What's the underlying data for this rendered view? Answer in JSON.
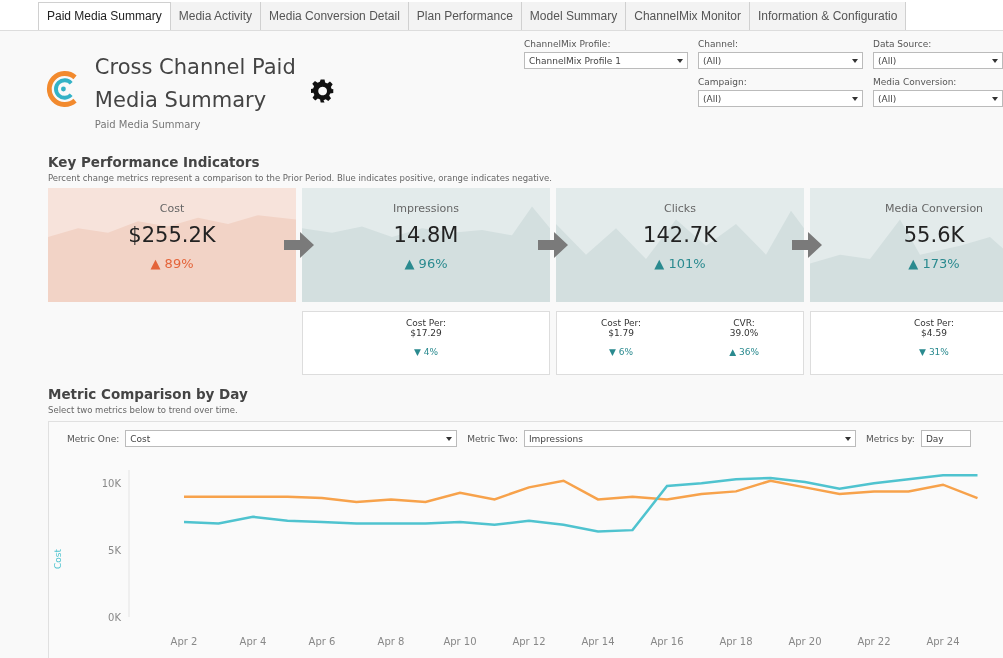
{
  "tabs": [
    {
      "label": "Paid Media Summary",
      "selected": true
    },
    {
      "label": "Media Activity",
      "selected": false
    },
    {
      "label": "Media Conversion Detail",
      "selected": false
    },
    {
      "label": "Plan Performance",
      "selected": false
    },
    {
      "label": "Model Summary",
      "selected": false
    },
    {
      "label": "ChannelMix Monitor",
      "selected": false
    },
    {
      "label": "Information & Configuratio",
      "selected": false
    }
  ],
  "header": {
    "title": "Cross Channel Paid Media Summary",
    "subtitle": "Paid Media Summary"
  },
  "filters": [
    {
      "label": "ChannelMix Profile:",
      "value": "ChannelMix Profile 1"
    },
    {
      "label": "Channel:",
      "value": "(All)"
    },
    {
      "label": "Data Source:",
      "value": "(All)"
    },
    {
      "label": "Campaign:",
      "value": "(All)"
    },
    {
      "label": "Media Conversion:",
      "value": "(All)"
    }
  ],
  "kpi_section": {
    "title": "Key Performance Indicators",
    "note": "Percent change metrics represent a comparison to the Prior Period. Blue indicates positive, orange indicates negative.",
    "kpis": [
      {
        "label": "Cost",
        "value": "$255.2K",
        "change": "▲ 89%",
        "positive": false
      },
      {
        "label": "Impressions",
        "value": "14.8M",
        "change": "▲ 96%",
        "positive": true,
        "details": [
          {
            "label": "Cost Per:",
            "value": "$17.29",
            "change": "▼ 4%",
            "positive": true
          }
        ]
      },
      {
        "label": "Clicks",
        "value": "142.7K",
        "change": "▲ 101%",
        "positive": true,
        "details": [
          {
            "label": "Cost Per:",
            "value": "$1.79",
            "change": "▼ 6%",
            "positive": true
          },
          {
            "label": "CVR:",
            "value": "39.0%",
            "change": "▲ 36%",
            "positive": true
          }
        ]
      },
      {
        "label": "Media Conversion",
        "value": "55.6K",
        "change": "▲ 173%",
        "positive": true,
        "details": [
          {
            "label": "Cost Per:",
            "value": "$4.59",
            "change": "▼ 31%",
            "positive": true
          }
        ]
      }
    ]
  },
  "comparison": {
    "title": "Metric Comparison by Day",
    "note": "Select two metrics below to trend over time.",
    "controls": [
      {
        "label": "Metric One:",
        "value": "Cost"
      },
      {
        "label": "Metric Two:",
        "value": "Impressions"
      },
      {
        "label": "Metrics by:",
        "value": "Day"
      }
    ],
    "chart_data": {
      "type": "line",
      "ylabel": "Cost",
      "categories": [
        "Apr 2",
        null,
        "Apr 4",
        null,
        "Apr 6",
        null,
        "Apr 8",
        null,
        "Apr 10",
        null,
        "Apr 12",
        null,
        "Apr 14",
        null,
        "Apr 16",
        null,
        "Apr 18",
        null,
        "Apr 20",
        null,
        "Apr 22",
        null,
        "Apr 24",
        null
      ],
      "series": [
        {
          "color": "#4fc3cf",
          "values": [
            7100,
            7000,
            7500,
            7200,
            7100,
            7000,
            7000,
            7000,
            7100,
            6900,
            7200,
            6900,
            6400,
            6500,
            9800,
            10000,
            10300,
            10400,
            10100,
            9600,
            10000,
            10300,
            10600,
            10600
          ]
        },
        {
          "color": "#f7a24b",
          "values": [
            9000,
            9000,
            9000,
            9000,
            8900,
            8600,
            8800,
            8600,
            9300,
            8800,
            9700,
            10200,
            8800,
            9000,
            8800,
            9200,
            9400,
            10200,
            9700,
            9200,
            9400,
            9400,
            9900,
            8900
          ]
        }
      ],
      "ylim": [
        0,
        11000
      ],
      "yticks": [
        {
          "value": 0,
          "label": "0K"
        },
        {
          "value": 5000,
          "label": "5K"
        },
        {
          "value": 10000,
          "label": "10K"
        }
      ]
    }
  }
}
